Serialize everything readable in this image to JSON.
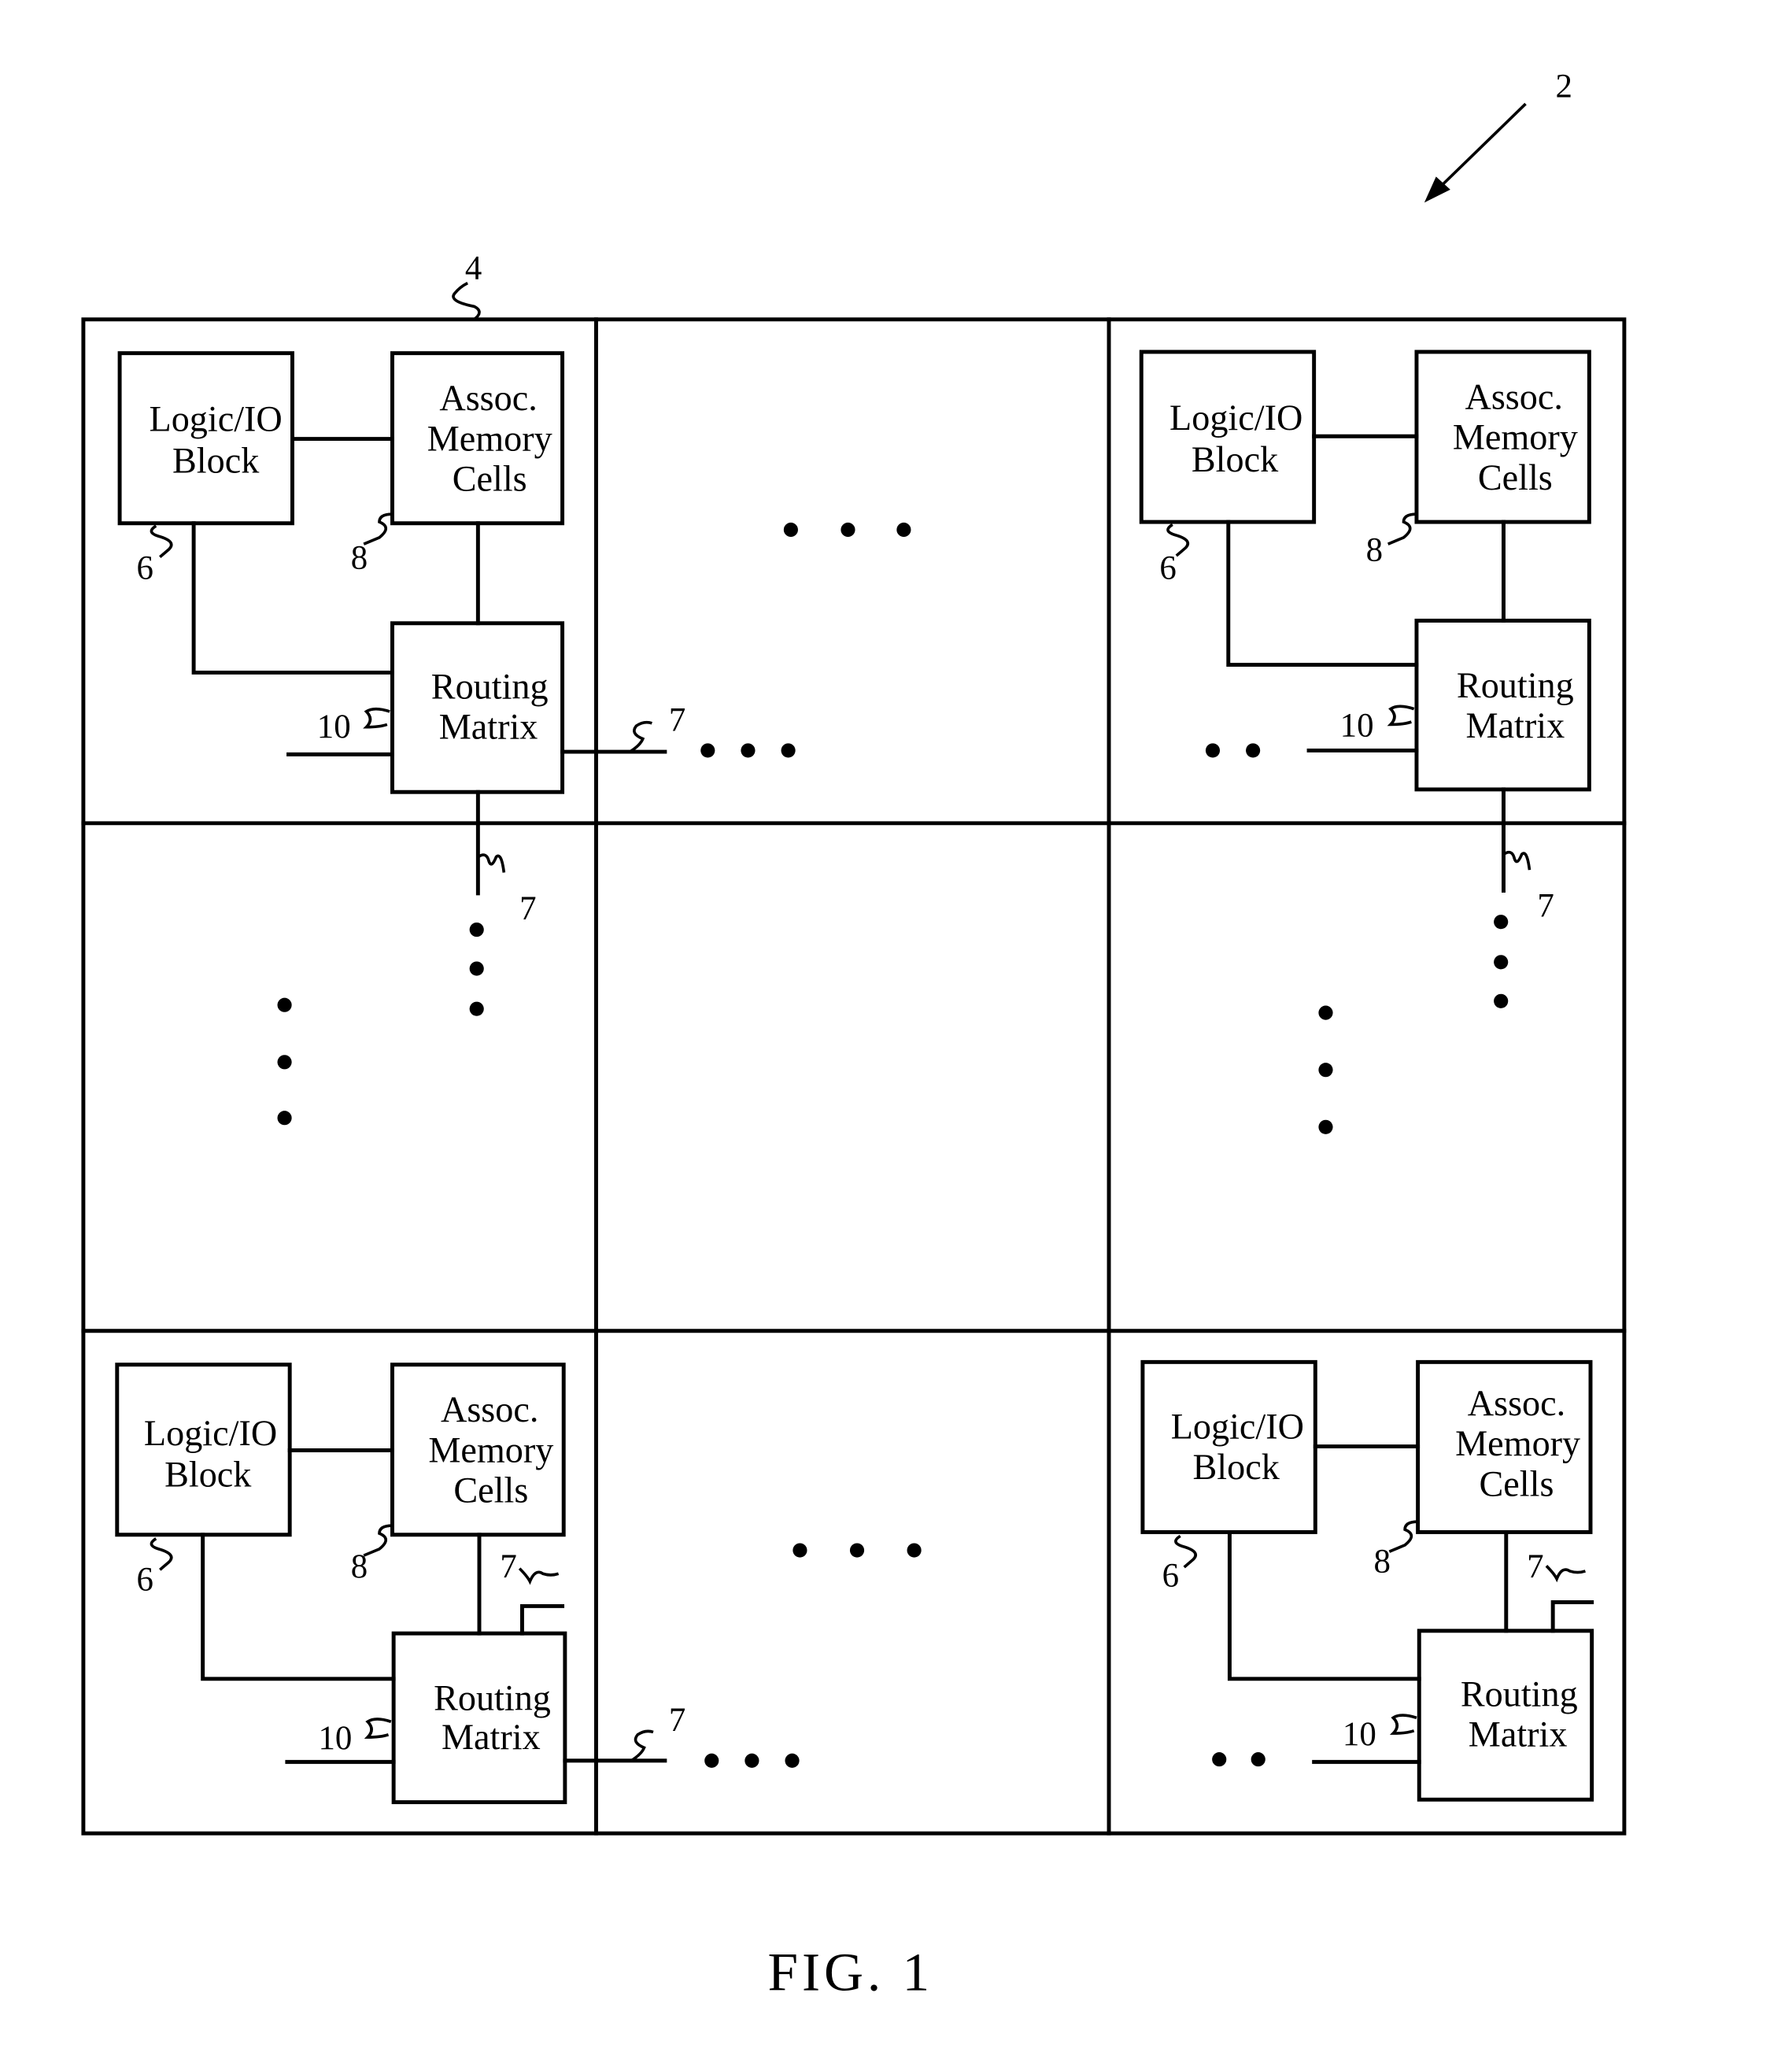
{
  "figure": {
    "caption": "FIG. 1",
    "device_ref": "2",
    "tile_ref": "4",
    "continuation": "• • •",
    "continuation_short": "• •"
  },
  "block_labels": {
    "logic_line1": "Logic/IO",
    "logic_line2": "Block",
    "mem_line1": "Assoc.",
    "mem_line2": "Memory",
    "mem_line3": "Cells",
    "route_line1": "Routing",
    "route_line2": "Matrix"
  },
  "refs": {
    "logic": "6",
    "interconnect": "7",
    "memory": "8",
    "routing": "10"
  },
  "tiles": [
    {
      "position": "top-left"
    },
    {
      "position": "top-right"
    },
    {
      "position": "bottom-left"
    },
    {
      "position": "bottom-right"
    }
  ]
}
